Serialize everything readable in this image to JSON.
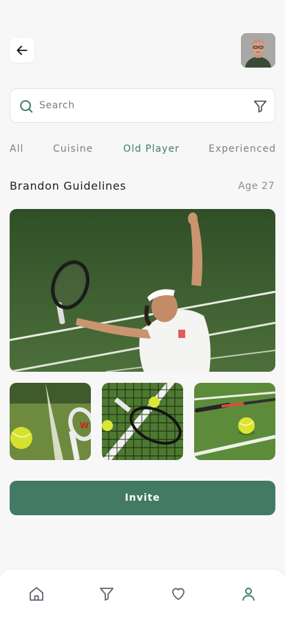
{
  "header": {
    "back_icon": "arrow-left-icon",
    "avatar": "user-profile-photo"
  },
  "search": {
    "placeholder": "Search",
    "value": "",
    "icon": "search-icon",
    "filter_icon": "filter-icon"
  },
  "categories": [
    {
      "label": "All",
      "active": false
    },
    {
      "label": "Cuisine",
      "active": false
    },
    {
      "label": "Old Player",
      "active": true
    },
    {
      "label": "Experienced",
      "active": false
    }
  ],
  "player": {
    "name": "Brandon Guidelines",
    "age": "Age 27"
  },
  "gallery": {
    "hero": "tennis-player-serving-photo",
    "thumbnails": [
      "racket-and-ball-on-grass-photo",
      "racket-at-net-photo",
      "racket-and-ball-on-court-photo"
    ]
  },
  "invite_button": "Invite",
  "tabbar": {
    "items": [
      "home-icon",
      "filter-icon",
      "heart-icon",
      "user-icon"
    ],
    "active_index": 3
  },
  "colors": {
    "accent": "#437a65",
    "active_chip": "#3e7a62",
    "background": "#f7f7f8"
  }
}
